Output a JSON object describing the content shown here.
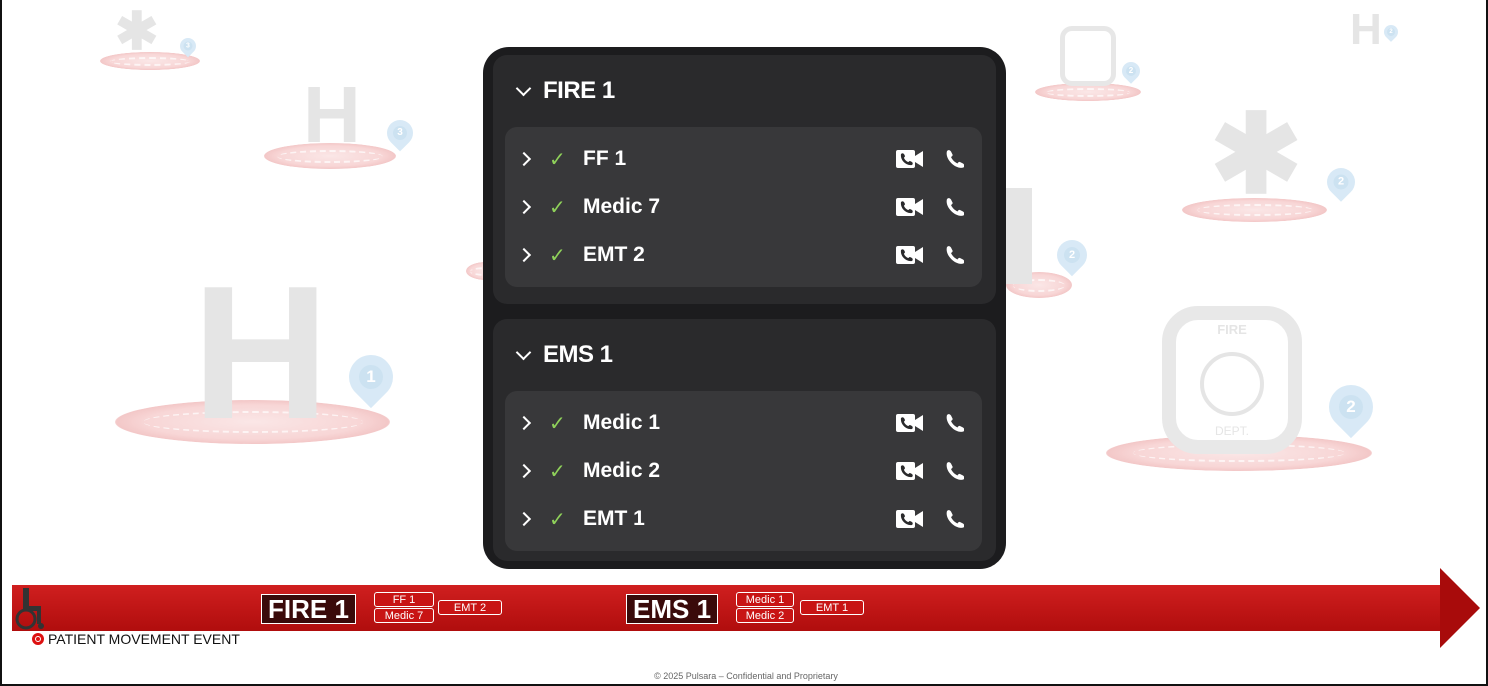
{
  "panel": {
    "groups": [
      {
        "title": "FIRE 1",
        "units": [
          {
            "name": "FF 1",
            "status": "✓"
          },
          {
            "name": "Medic 7",
            "status": "✓"
          },
          {
            "name": "EMT 2",
            "status": "✓"
          }
        ]
      },
      {
        "title": "EMS 1",
        "units": [
          {
            "name": "Medic 1",
            "status": "✓"
          },
          {
            "name": "Medic 2",
            "status": "✓"
          },
          {
            "name": "EMT 1",
            "status": "✓"
          }
        ]
      }
    ],
    "icons": {
      "expand_group": "chevron-down-icon",
      "expand_unit": "chevron-right-icon",
      "status": "check-icon",
      "video": "video-call-icon",
      "call": "phone-icon"
    }
  },
  "background_markers": {
    "hospital_letter": "H",
    "pins": [
      "1",
      "2",
      "2",
      "3",
      "3",
      "2",
      "2"
    ],
    "fire_badge_top": "FIRE",
    "fire_badge_bottom": "DEPT."
  },
  "timeline": {
    "groups": [
      {
        "label": "FIRE 1",
        "chips": [
          "FF 1",
          "Medic 7",
          "EMT 2"
        ]
      },
      {
        "label": "EMS 1",
        "chips": [
          "Medic 1",
          "Medic 2",
          "EMT 1"
        ]
      }
    ],
    "event_label": "PATIENT MOVEMENT EVENT"
  },
  "footer": "© 2025 Pulsara – Confidential and Proprietary",
  "colors": {
    "panel": "#1c1c1e",
    "group": "#2a2a2c",
    "unit_list": "#38383a",
    "check": "#8fd15a",
    "arrow": "#c81414"
  }
}
